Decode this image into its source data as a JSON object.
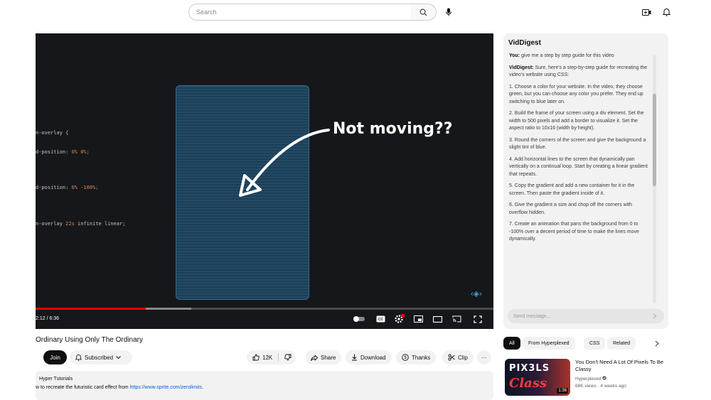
{
  "search": {
    "placeholder": "Search"
  },
  "player": {
    "code_lines": [
      {
        "text": "n-overlay {",
        "num": ""
      },
      {
        "text": "d-position: ",
        "num": "0% 0%;"
      },
      {
        "text": "d-position: ",
        "num": "0% -100%;"
      },
      {
        "text": "n-overlay ",
        "num": "22s",
        "rest": " infinite linear;"
      }
    ],
    "overlay_text": "Not moving??",
    "time": "2:12 / 6:36",
    "progress": 0.24,
    "buffered": 0.34
  },
  "chat": {
    "title": "VidDigest",
    "messages": [
      {
        "speaker": "You:",
        "text": " give me a step by step guide for this video"
      },
      {
        "speaker": "VidDigest:",
        "text": " Sure, here's a step-by-step guide for recreating the video's website using CSS:"
      },
      {
        "speaker": "",
        "text": "1. Choose a color for your website. In the video, they choose green, but you can choose any color you prefer. They end up switching to blue later on."
      },
      {
        "speaker": "",
        "text": "2. Build the frame of your screen using a div element. Set the width to 500 pixels and add a border to visualize it. Set the aspect ratio to 10x16 (width by height)."
      },
      {
        "speaker": "",
        "text": "3. Round the corners of the screen and give the background a slight tint of blue."
      },
      {
        "speaker": "",
        "text": "4. Add horizontal lines to the screen that dynamically pan vertically on a continual loop. Start by creating a linear gradient that repeats."
      },
      {
        "speaker": "",
        "text": "5. Copy the gradient and add a new container for it in the screen. Then paste the gradient inside of it."
      },
      {
        "speaker": "",
        "text": "6. Give the gradient a size and chop off the corners with overflow hidden."
      },
      {
        "speaker": "",
        "text": "7. Create an animation that pans the background from 0 to -100% over a decent period of time to make the lines move dynamically."
      }
    ],
    "input_placeholder": "Send message..."
  },
  "video": {
    "title": "Ordinary Using Only The Ordinary",
    "join_label": "Join",
    "subscribed_label": "Subscribed",
    "like_count": "12K",
    "share_label": "Share",
    "download_label": "Download",
    "thanks_label": "Thanks",
    "clip_label": "Clip",
    "more_label": "···"
  },
  "description": {
    "line1": "Hyper Tutorials",
    "line2_prefix": "w to recreate the futuristic card effect from ",
    "line2_link": "https://www.sprite.com/zerolimits",
    "line2_suffix": "."
  },
  "chips": [
    "All",
    "From Hyperplexed",
    "CSS",
    "Related"
  ],
  "recommendation": {
    "thumb_line1": "PIX3LS",
    "thumb_line2": "Class",
    "duration": "1:36",
    "title": "You Don't Need A Lot Of Pixels To Be Classy",
    "channel": "Hyperplexed",
    "meta": "68K views · 4 weeks ago"
  }
}
